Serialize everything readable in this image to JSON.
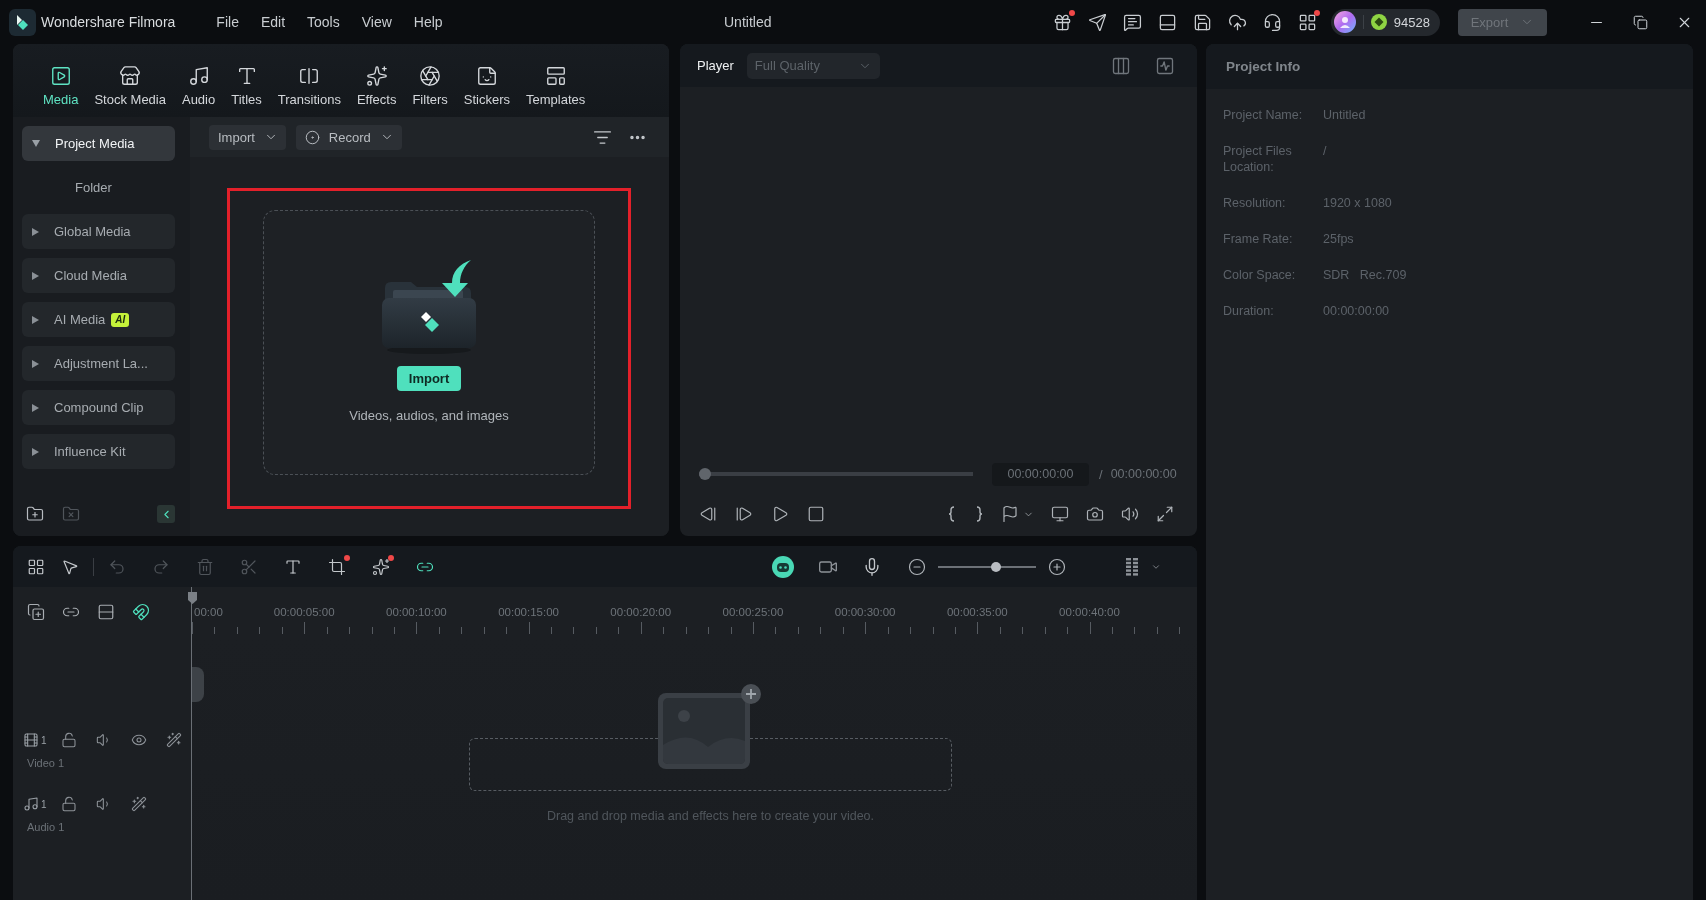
{
  "app": {
    "name": "Wondershare Filmora",
    "menu": [
      {
        "label": "File"
      },
      {
        "label": "Edit"
      },
      {
        "label": "Tools"
      },
      {
        "label": "View"
      },
      {
        "label": "Help"
      }
    ],
    "title": "Untitled"
  },
  "top_bar": {
    "icons": [
      {
        "kind": "gift",
        "dot": true
      },
      {
        "kind": "send",
        "dot": false
      },
      {
        "kind": "feedback",
        "dot": false
      },
      {
        "kind": "layout",
        "dot": false
      },
      {
        "kind": "save",
        "dot": false
      },
      {
        "kind": "cloud",
        "dot": false
      },
      {
        "kind": "support",
        "dot": false
      },
      {
        "kind": "apps",
        "dot": true
      }
    ],
    "credits": "94528",
    "export": {
      "label": "Export",
      "disabled": true
    }
  },
  "media_panel": {
    "tabs": [
      {
        "label": "Media",
        "selected": true
      },
      {
        "label": "Stock Media",
        "selected": false
      },
      {
        "label": "Audio",
        "selected": false
      },
      {
        "label": "Titles",
        "selected": false
      },
      {
        "label": "Transitions",
        "selected": false
      },
      {
        "label": "Effects",
        "selected": false
      },
      {
        "label": "Filters",
        "selected": false
      },
      {
        "label": "Stickers",
        "selected": false
      },
      {
        "label": "Templates",
        "selected": false
      }
    ],
    "sidebar": {
      "items": [
        {
          "label": "Project Media",
          "selected": true,
          "expanded": true,
          "children": [
            {
              "label": "Folder",
              "selected": false
            }
          ]
        },
        {
          "label": "Global Media",
          "selected": false,
          "expanded": false
        },
        {
          "label": "Cloud Media",
          "selected": false,
          "expanded": false
        },
        {
          "label": "AI Media",
          "badge": "AI",
          "selected": false,
          "expanded": false
        },
        {
          "label": "Adjustment La...",
          "selected": false,
          "expanded": false
        },
        {
          "label": "Compound Clip",
          "selected": false,
          "expanded": false
        },
        {
          "label": "Influence Kit",
          "selected": false,
          "expanded": false
        }
      ]
    },
    "toolbar": {
      "import": "Import",
      "record": "Record"
    },
    "drop_zone": {
      "highlighted": true,
      "button": "Import",
      "hint": "Videos, audios, and images"
    }
  },
  "player": {
    "title": "Player",
    "quality": "Full Quality",
    "progress": {
      "level": 0
    },
    "current_time": "00:00:00:00",
    "separator": "/",
    "total_time": "00:00:00:00"
  },
  "project_info": {
    "title": "Project Info",
    "rows": [
      {
        "label": "Project Name:",
        "value": "Untitled"
      },
      {
        "label": "Project Files Location:",
        "value": "/"
      },
      {
        "label": "Resolution:",
        "value": "1920 x 1080"
      },
      {
        "label": "Frame Rate:",
        "value": "25fps"
      },
      {
        "label": "Color Space:",
        "value": "SDR   Rec.709"
      },
      {
        "label": "Duration:",
        "value": "00:00:00:00"
      }
    ]
  },
  "timeline": {
    "tool_groups": [
      {
        "tools": [
          {
            "kind": "layout",
            "disabled": false,
            "dot": false,
            "active": false
          },
          {
            "kind": "select",
            "disabled": false,
            "dot": false,
            "active": false
          }
        ]
      },
      {
        "tools": [
          {
            "kind": "undo",
            "disabled": true,
            "dot": false,
            "active": false
          },
          {
            "kind": "redo",
            "disabled": true,
            "dot": false,
            "active": false
          },
          {
            "kind": "delete",
            "disabled": true,
            "dot": false,
            "active": false
          },
          {
            "kind": "cut",
            "disabled": true,
            "dot": false,
            "active": false
          },
          {
            "kind": "text",
            "disabled": false,
            "dot": false,
            "active": false
          },
          {
            "kind": "crop",
            "disabled": false,
            "dot": true,
            "active": false
          },
          {
            "kind": "ai",
            "disabled": false,
            "dot": true,
            "active": false
          },
          {
            "kind": "link",
            "disabled": false,
            "dot": false,
            "active": true
          }
        ]
      }
    ],
    "right_tools": [
      {
        "kind": "assistant",
        "active": true
      },
      {
        "kind": "camera",
        "active": false
      },
      {
        "kind": "mic",
        "active": false
      }
    ],
    "zoom": {
      "level": 0.6
    },
    "header_tools": [
      {
        "kind": "add_track",
        "active": false
      },
      {
        "kind": "link",
        "active": false
      },
      {
        "kind": "rows",
        "active": false
      },
      {
        "kind": "magnet",
        "active": true
      }
    ],
    "ruler": [
      "00:00",
      "00:00:05:00",
      "00:00:10:00",
      "00:00:15:00",
      "00:00:20:00",
      "00:00:25:00",
      "00:00:30:00",
      "00:00:35:00",
      "00:00:40:00"
    ],
    "tracks": [
      {
        "kind": "video",
        "number": "1",
        "name": "Video 1"
      },
      {
        "kind": "audio",
        "number": "1",
        "name": "Audio 1"
      }
    ],
    "drop_hint": "Drag and drop media and effects here to create your video."
  }
}
